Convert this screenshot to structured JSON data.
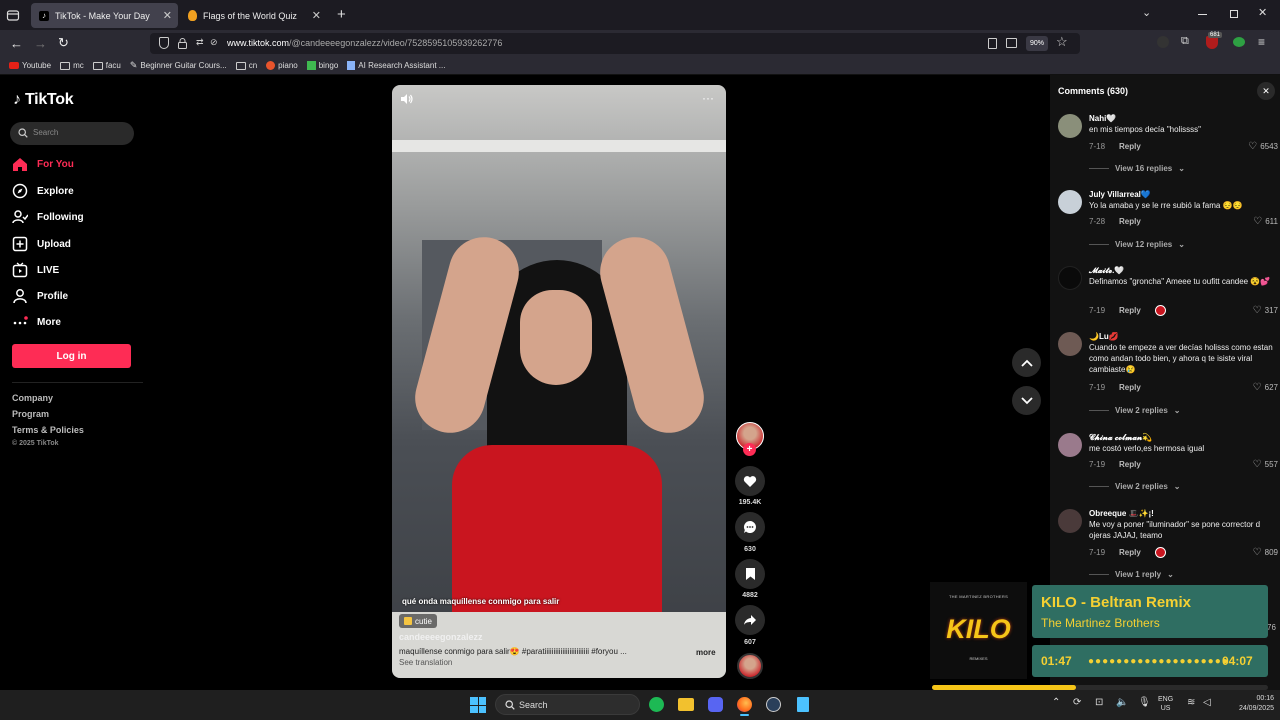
{
  "browser": {
    "tabs": [
      {
        "title": "TikTok - Make Your Day",
        "active": true
      },
      {
        "title": "Flags of the World Quiz",
        "active": false
      }
    ],
    "url_host": "www.tiktok.com",
    "url_path": "/@candeeeegonzalezz/video/7528595105939262776",
    "zoom": "90%",
    "bookmarks": [
      "Youtube",
      "mc",
      "facu",
      "Beginner Guitar Cours...",
      "cn",
      "piano",
      "bingo",
      "AI Research Assistant ..."
    ],
    "extension_badge": "681"
  },
  "sidebar": {
    "logo": "TikTok",
    "search_placeholder": "Search",
    "items": [
      {
        "label": "For You",
        "icon": "home-icon",
        "active": true
      },
      {
        "label": "Explore",
        "icon": "compass-icon"
      },
      {
        "label": "Following",
        "icon": "following-icon"
      },
      {
        "label": "Upload",
        "icon": "upload-icon"
      },
      {
        "label": "LIVE",
        "icon": "live-icon"
      },
      {
        "label": "Profile",
        "icon": "profile-icon"
      },
      {
        "label": "More",
        "icon": "more-icon"
      }
    ],
    "login_label": "Log in",
    "footer": [
      "Company",
      "Program",
      "Terms & Policies"
    ],
    "copyright": "© 2025 TikTok"
  },
  "video": {
    "caption_overlay": "qué onda maquíllense conmigo para salir",
    "tag": "cutie",
    "username": "candeeeegonzalezz",
    "description": "maquíllense conmigo para salir😍 #paratiiiiiiiiiiiiiiiiiiiiiiiii  #foryou  ...",
    "more_label": "more",
    "see_translation": "See translation",
    "likes": "195.4K",
    "comments": "630",
    "saves": "4882",
    "shares": "607"
  },
  "comments_panel": {
    "title": "Comments (630)",
    "comments": [
      {
        "name": "Nahi🤍",
        "text": "en mis tiempos decía \"holissss\"",
        "date": "7-18",
        "likes": "6543",
        "replies": "View 16 replies"
      },
      {
        "name": "July Villarreal💙",
        "text": "Yo la amaba y se le rre subió la fama 😔😔",
        "date": "7-28",
        "likes": "611",
        "replies": "View 12 replies"
      },
      {
        "name": "𝓜𝓪𝓲𝓽𝓮.🤍",
        "text": "Definamos \"groncha\" Ameee tu oufitt candee 😵💕",
        "date": "7-19",
        "likes": "317",
        "replies": ""
      },
      {
        "name": "🌙Lu💋",
        "text": "Cuando te empeze a ver decías holisss como estan como andan todo bien, y ahora q te isiste viral cambiaste😢",
        "date": "7-19",
        "likes": "627",
        "replies": "View 2 replies"
      },
      {
        "name": "𝓒𝓱𝓲𝓷𝓪 𝓬𝓸𝓵𝓶𝓪𝓷💫",
        "text": "me costó verlo,es hermosa igual",
        "date": "7-19",
        "likes": "557",
        "replies": "View 2 replies"
      },
      {
        "name": "Obreeque 🎩✨¡!",
        "text": "Me voy a poner \"iluminador\" se pone corrector d ojeras JAJAJ, teamo",
        "date": "7-19",
        "likes": "809",
        "replies": "View 1 reply"
      }
    ],
    "reply_label": "Reply",
    "partial_count": "76"
  },
  "media_player": {
    "album_text": "KILO",
    "album_top": "THE MARTINEZ BROTHERS",
    "album_bottom": "REMIXES",
    "track": "KILO - Beltran Remix",
    "artist": "The Martinez Brothers",
    "elapsed": "01:47",
    "total": "04:07",
    "progress": 0.43
  },
  "taskbar": {
    "search_placeholder": "Search",
    "lang_top": "ENG",
    "lang_bottom": "US",
    "time": "00:16",
    "date": "24/09/2025"
  }
}
